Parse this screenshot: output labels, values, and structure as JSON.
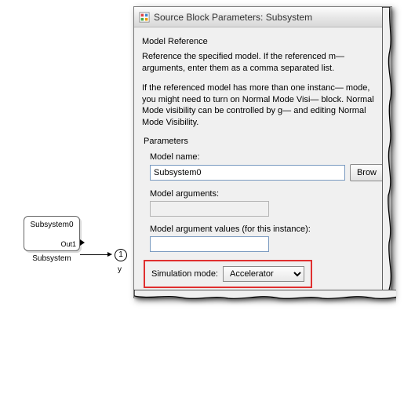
{
  "block": {
    "name": "Subsystem0",
    "out_label": "Out1",
    "caption": "Subsystem",
    "outport_num": "1",
    "outport_name": "y"
  },
  "dialog": {
    "title": "Source Block Parameters: Subsystem",
    "section": "Model Reference",
    "desc1": "Reference the specified model. If the referenced m— arguments, enter them as a comma separated list.",
    "desc2": "If the referenced model has more than one instanc— mode, you might need to turn on Normal Mode Visi— block. Normal Mode visibility can be controlled by g— and editing Normal Mode Visibility.",
    "params_label": "Parameters",
    "model_name_label": "Model name:",
    "model_name_value": "Subsystem0",
    "browse_label": "Brow",
    "model_args_label": "Model arguments:",
    "model_args_value": "",
    "model_argvals_label": "Model argument values (for this instance):",
    "model_argvals_value": "",
    "sim_mode_label": "Simulation mode:",
    "sim_mode_value": "Accelerator"
  }
}
